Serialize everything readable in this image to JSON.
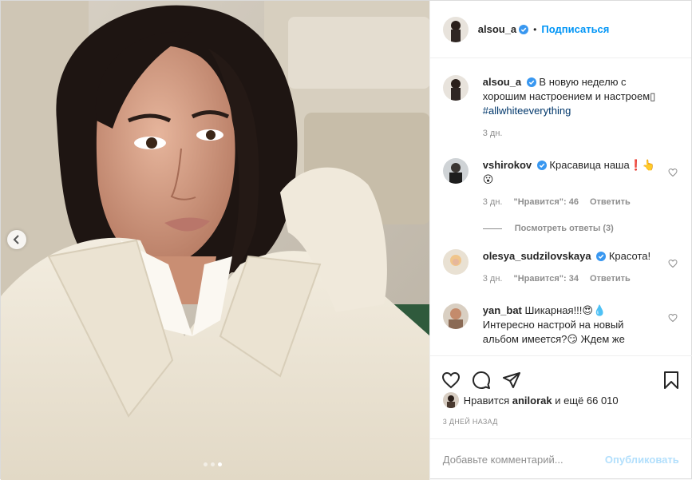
{
  "post": {
    "author": "alsou_a",
    "follow_label": "Подписаться",
    "separator": "•",
    "carousel": {
      "total": 3,
      "active_index": 2
    },
    "icons": {
      "prev": "chevron-left-icon",
      "verified": "verified-badge-icon"
    }
  },
  "comments": [
    {
      "username": "alsou_a",
      "text": "В новую неделю с хорошим настроением и настроем",
      "glyph": "▯",
      "hashtag": "#allwhiteeverything",
      "time": "3 дн."
    },
    {
      "username": "vshirokov",
      "text": "Красавица наша❗👆",
      "text2": "😮",
      "time": "3 дн.",
      "likes": "\"Нравится\": 46",
      "reply": "Ответить",
      "view_replies": "Посмотреть ответы (3)"
    },
    {
      "username": "olesya_sudzilovskaya",
      "text": "Красота!",
      "time": "3 дн.",
      "likes": "\"Нравится\": 34",
      "reply": "Ответить"
    },
    {
      "username": "yan_bat",
      "text": "Шикарная!!!😍💧",
      "text2": "Интересно настрой на новый",
      "text3": "альбом имеется?😏 Ждем же"
    }
  ],
  "actions": {
    "like": "heart-icon",
    "comment": "comment-icon",
    "share": "share-icon",
    "save": "bookmark-icon"
  },
  "likes_line": {
    "prefix": "Нравится",
    "user": "anilorak",
    "suffix": "и ещё 66 010"
  },
  "timestamp": "3 дней назад",
  "add_comment": {
    "placeholder": "Добавьте комментарий...",
    "publish": "Опубликовать"
  },
  "colors": {
    "accent": "#0095f6",
    "publish_disabled": "#b2dffc",
    "muted": "#8e8e8e",
    "hashtag": "#00376b"
  }
}
